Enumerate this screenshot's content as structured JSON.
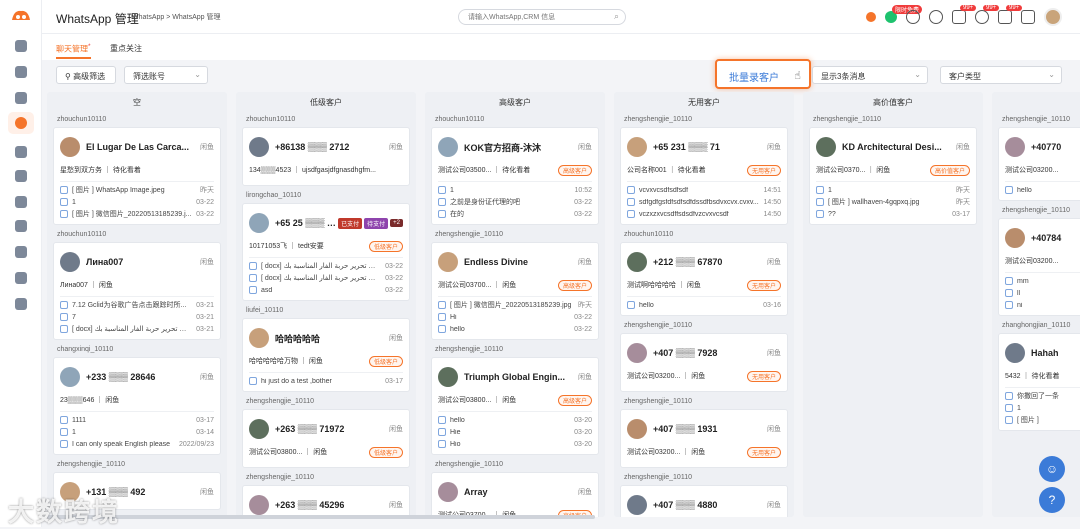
{
  "app": {
    "title": "WhatsApp 管理",
    "breadcrumb": "WhatsApp > WhatsApp 管理",
    "search_placeholder": "请输入WhatsApp,CRM 信息"
  },
  "accent": "#f5742a",
  "topbar_badges": {
    "free": "限时免费",
    "mail": "99+",
    "chat": "99+",
    "apps": "99+"
  },
  "tabs": [
    {
      "label": "聊天管理",
      "marker": "*"
    },
    {
      "label": "重点关注"
    }
  ],
  "filters": {
    "advanced": "高级筛选",
    "account": "筛选账号",
    "batch": "批量录客户",
    "display": "显示3条消息",
    "customer_type": "客户类型"
  },
  "watermark": "大数跨境",
  "columns": [
    {
      "title": "空",
      "groups": [
        {
          "account": "zhouchun10110",
          "cards": [
            {
              "name": "El Lugar De Las Carca...",
              "status": "闲鱼",
              "meta": "星愁到双方务 ｜ 待化看着",
              "tag": "",
              "msgs": [
                {
                  "t": "[ 图片 ] WhatsApp Image.jpeg",
                  "time": "昨天"
                },
                {
                  "t": "1",
                  "time": "03-22"
                },
                {
                  "t": "[ 图片 ] 微信图片_20220513185239.j...",
                  "time": "03-22"
                }
              ]
            }
          ]
        },
        {
          "account": "zhouchun10110",
          "cards": [
            {
              "name": "Лина007",
              "status": "闲鱼",
              "meta": "Лина007 ｜ 闲鱼",
              "tag": "",
              "msgs": [
                {
                  "t": "7.12 Gclid为谷歌广告点击跟踪时所...",
                  "time": "03-21"
                },
                {
                  "t": "7",
                  "time": "03-21"
                },
                {
                  "t": "[ docx] يشكو لرب تحرير حربة الفار المناسبة بك",
                  "time": "03-21"
                }
              ]
            }
          ]
        },
        {
          "account": "changxinqi_10110",
          "cards": [
            {
              "name": "+233 ▒▒▒ 28646",
              "status": "闲鱼",
              "meta": "23▒▒▒646 ｜ 闲鱼",
              "tag": "",
              "msgs": [
                {
                  "t": "1111",
                  "time": "03-17"
                },
                {
                  "t": "1",
                  "time": "03-14"
                },
                {
                  "t": "I can only speak English please",
                  "time": "2022/09/23"
                }
              ]
            }
          ]
        },
        {
          "account": "zhengshengjie_10110",
          "cards": [
            {
              "name": "+131 ▒▒▒ 492",
              "status": "闲鱼",
              "meta": "",
              "tag": "",
              "msgs": []
            }
          ]
        }
      ]
    },
    {
      "title": "低级客户",
      "groups": [
        {
          "account": "zhouchun10110",
          "cards": [
            {
              "name": "+86138 ▒▒▒ 2712",
              "status": "闲鱼",
              "meta": "134▒▒▒4523 ｜ ujsdfgasjdfgnasdhgfm...",
              "tag": "",
              "msgs": []
            }
          ]
        },
        {
          "account": "lirongchao_10110",
          "cards": [
            {
              "name": "+65 25 ▒▒▒ 471",
              "status": "",
              "meta": "10171053飞 ｜ tedt安要",
              "tag": "低级客户",
              "extra": [
                "已支付",
                "待支付",
                "+2"
              ],
              "msgs": [
                {
                  "t": "[ docx] يشكو لرب تحرير حربة الفار المناسبة بك",
                  "time": "03-22"
                },
                {
                  "t": "[ docx] يشكو لرب تحرير حربة الفار المناسبة بك",
                  "time": "03-22"
                },
                {
                  "t": "asd",
                  "time": "03-22"
                }
              ]
            }
          ]
        },
        {
          "account": "liufei_10110",
          "cards": [
            {
              "name": "哈哈哈哈哈",
              "status": "闲鱼",
              "meta": "哈哈哈哈哈万物 ｜ 闲鱼",
              "tag": "低级客户",
              "msgs": [
                {
                  "t": "hi just do a test ,bother",
                  "time": "03-17"
                }
              ]
            }
          ]
        },
        {
          "account": "zhengshengjie_10110",
          "cards": [
            {
              "name": "+263 ▒▒▒ 71972",
              "status": "闲鱼",
              "meta": "测试公司03800... ｜ 闲鱼",
              "tag": "低级客户",
              "msgs": []
            }
          ]
        },
        {
          "account": "zhengshengjie_10110",
          "cards": [
            {
              "name": "+263 ▒▒▒ 45296",
              "status": "闲鱼",
              "meta": "测试公司03800... ｜ 闲鱼",
              "tag": "低级客户",
              "msgs": []
            }
          ]
        }
      ]
    },
    {
      "title": "高级客户",
      "groups": [
        {
          "account": "zhouchun10110",
          "cards": [
            {
              "name": "KOK官方招商-沐沐",
              "status": "闲鱼",
              "meta": "测试公司03500... ｜ 待化看着",
              "tag": "高级客户",
              "msgs": [
                {
                  "t": "1",
                  "time": "10:52"
                },
                {
                  "t": "之前是身份证代理的吧",
                  "time": "03-22"
                },
                {
                  "t": "在的",
                  "time": "03-22"
                }
              ]
            }
          ]
        },
        {
          "account": "zhengshengjie_10110",
          "cards": [
            {
              "name": "Endless Divine",
              "status": "闲鱼",
              "meta": "测试公司03700... ｜ 闲鱼",
              "tag": "高级客户",
              "msgs": [
                {
                  "t": "[ 图片 ] 微信图片_20220513185239.jpg",
                  "time": "昨天"
                },
                {
                  "t": "Hi",
                  "time": "03-22"
                },
                {
                  "t": "hello",
                  "time": "03-22"
                }
              ]
            }
          ]
        },
        {
          "account": "zhengshengjie_10110",
          "cards": [
            {
              "name": "Triumph Global Engin...",
              "status": "闲鱼",
              "meta": "测试公司03800... ｜ 闲鱼",
              "tag": "高级客户",
              "msgs": [
                {
                  "t": "hello",
                  "time": "03-20"
                },
                {
                  "t": "Hie",
                  "time": "03-20"
                },
                {
                  "t": "Hio",
                  "time": "03-20"
                }
              ]
            }
          ]
        },
        {
          "account": "zhengshengjie_10110",
          "cards": [
            {
              "name": "Array",
              "status": "闲鱼",
              "meta": "测试公司03700... ｜ 闲鱼",
              "tag": "高级客户",
              "msgs": []
            }
          ]
        }
      ]
    },
    {
      "title": "无用客户",
      "groups": [
        {
          "account": "zhengshengjie_10110",
          "cards": [
            {
              "name": "+65 231 ▒▒▒ 71",
              "status": "闲鱼",
              "meta": "公司名称001 ｜ 待化看着",
              "tag": "无用客户",
              "msgs": [
                {
                  "t": "vcvxvcsdfsdfsdf",
                  "time": "14:51"
                },
                {
                  "t": "sdfgdfgsfdfsdfsdfdssdfbsdvxcvx.cvxv...",
                  "time": "14:50"
                },
                {
                  "t": "vczxzxvcsdffsdsdfvzcvxvcsdf",
                  "time": "14:50"
                }
              ]
            }
          ]
        },
        {
          "account": "zhouchun10110",
          "cards": [
            {
              "name": "+212 ▒▒▒ 67870",
              "status": "闲鱼",
              "meta": "测试啊哈哈哈哈 ｜ 闲鱼",
              "tag": "无用客户",
              "msgs": [
                {
                  "t": "hello",
                  "time": "03-16"
                }
              ]
            }
          ]
        },
        {
          "account": "zhengshengjie_10110",
          "cards": [
            {
              "name": "+407 ▒▒▒ 7928",
              "status": "闲鱼",
              "meta": "测试公司03200... ｜ 闲鱼",
              "tag": "无用客户",
              "msgs": []
            }
          ]
        },
        {
          "account": "zhengshengjie_10110",
          "cards": [
            {
              "name": "+407 ▒▒▒ 1931",
              "status": "闲鱼",
              "meta": "测试公司03200... ｜ 闲鱼",
              "tag": "无用客户",
              "msgs": []
            }
          ]
        },
        {
          "account": "zhengshengjie_10110",
          "cards": [
            {
              "name": "+407 ▒▒▒ 4880",
              "status": "闲鱼",
              "meta": "测试公司03200... ｜ 闲鱼",
              "tag": "无用客户",
              "msgs": []
            }
          ]
        }
      ]
    },
    {
      "title": "高价值客户",
      "groups": [
        {
          "account": "zhengshengjie_10110",
          "cards": [
            {
              "name": "KD Architectural Desi...",
              "status": "闲鱼",
              "meta": "测试公司0370... ｜ 闲鱼",
              "tag": "高价值客户",
              "msgs": [
                {
                  "t": "1",
                  "time": "昨天"
                },
                {
                  "t": "[ 图片 ] wallhaven-4gqpxq.jpg",
                  "time": "昨天"
                },
                {
                  "t": "??",
                  "time": "03-17"
                }
              ]
            }
          ]
        }
      ]
    },
    {
      "title": "",
      "groups": [
        {
          "account": "zhengshengjie_10110",
          "cards": [
            {
              "name": "+40770",
              "status": "",
              "meta": "测试公司03200...",
              "tag": "",
              "msgs": [
                {
                  "t": "hello",
                  "time": ""
                }
              ]
            }
          ]
        },
        {
          "account": "zhengshengjie_10110",
          "cards": [
            {
              "name": "+40784",
              "status": "",
              "meta": "测试公司03200...",
              "tag": "",
              "msgs": [
                {
                  "t": "mm",
                  "time": ""
                },
                {
                  "t": "ll",
                  "time": ""
                },
                {
                  "t": "ni",
                  "time": ""
                }
              ]
            }
          ]
        },
        {
          "account": "zhanghongjian_10110",
          "cards": [
            {
              "name": "Hahah",
              "status": "",
              "meta": "5432 ｜ 待化看着",
              "tag": "",
              "msgs": [
                {
                  "t": "你撒回了一条",
                  "time": ""
                },
                {
                  "t": "1",
                  "time": ""
                },
                {
                  "t": "[ 图片 ]",
                  "time": ""
                }
              ]
            }
          ]
        }
      ]
    }
  ]
}
